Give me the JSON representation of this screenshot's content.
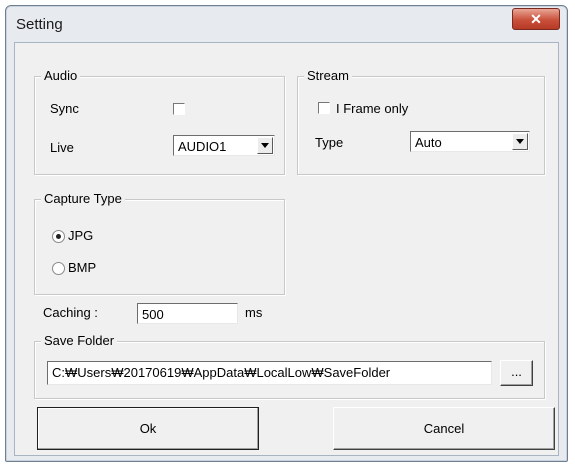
{
  "window": {
    "title": "Setting",
    "close_glyph": "✕"
  },
  "audio": {
    "legend": "Audio",
    "sync_label": "Sync",
    "sync_checked": false,
    "live_label": "Live",
    "live_value": "AUDIO1"
  },
  "stream": {
    "legend": "Stream",
    "iframe_label": "I Frame only",
    "iframe_checked": false,
    "type_label": "Type",
    "type_value": "Auto"
  },
  "capture": {
    "legend": "Capture Type",
    "options": [
      {
        "label": "JPG",
        "selected": true
      },
      {
        "label": "BMP",
        "selected": false
      }
    ]
  },
  "caching": {
    "label": "Caching :",
    "value": "500",
    "unit": "ms"
  },
  "save_folder": {
    "legend": "Save Folder",
    "path": "C:₩Users₩20170619₩AppData₩LocalLow₩SaveFolder",
    "browse_label": "..."
  },
  "buttons": {
    "ok_label": "Ok",
    "cancel_label": "Cancel"
  }
}
